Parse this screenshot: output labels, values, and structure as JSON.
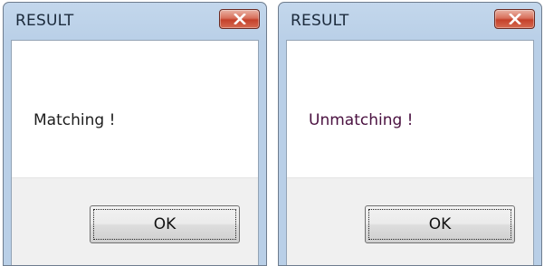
{
  "dialogs": [
    {
      "title": "RESULT",
      "message": "Matching !",
      "ok_label": "OK",
      "close_icon": "close-x-icon"
    },
    {
      "title": "RESULT",
      "message": "Unmatching !",
      "ok_label": "OK",
      "close_icon": "close-x-icon"
    }
  ],
  "colors": {
    "frame": "#b9cfe7",
    "close_button": "#c4412b",
    "button_area": "#f0f0f0",
    "message_matching": "#1e1e1e",
    "message_unmatching": "#4a1140"
  }
}
